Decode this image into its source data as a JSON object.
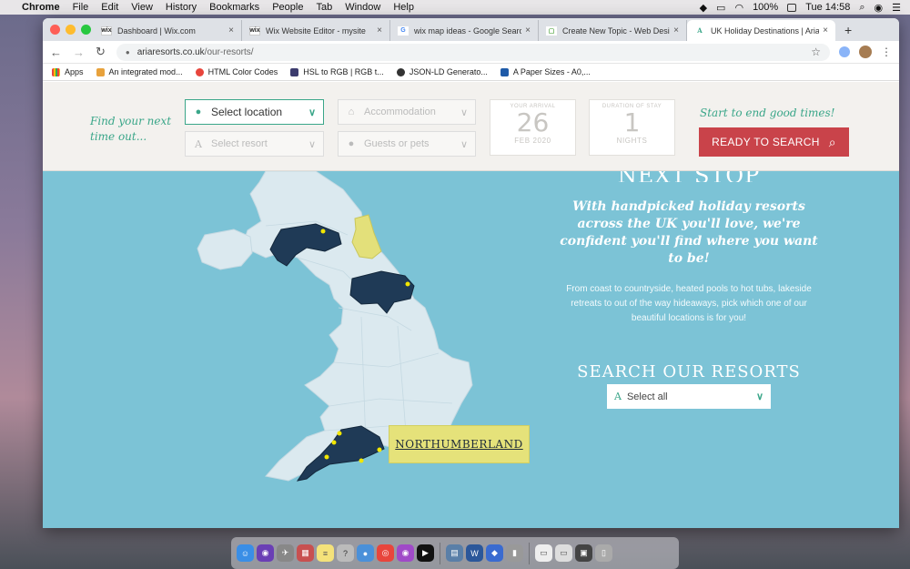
{
  "menubar": {
    "app_name": "Chrome",
    "items": [
      "File",
      "Edit",
      "View",
      "History",
      "Bookmarks",
      "People",
      "Tab",
      "Window",
      "Help"
    ],
    "battery": "100%",
    "clock": "Tue 14:58"
  },
  "tabs": [
    {
      "favicon": "wix",
      "title": "Dashboard | Wix.com",
      "active": false
    },
    {
      "favicon": "wix",
      "title": "Wix Website Editor - mysite",
      "active": false
    },
    {
      "favicon": "G",
      "title": "wix map ideas - Google Search",
      "active": false
    },
    {
      "favicon": "▢",
      "title": "Create New Topic - Web Design",
      "active": false
    },
    {
      "favicon": "A",
      "title": "UK Holiday Destinations | Aria R",
      "active": true
    }
  ],
  "new_tab_label": "+",
  "address": {
    "domain": "ariaresorts.co.uk",
    "path": "/our-resorts/"
  },
  "bookmarks": [
    {
      "label": "Apps",
      "color": "#e8453c"
    },
    {
      "label": "An integrated mod...",
      "color": "#e8a23c"
    },
    {
      "label": "HTML Color Codes",
      "color": "#e8453c"
    },
    {
      "label": "HSL to RGB | RGB t...",
      "color": "#3c3c6e"
    },
    {
      "label": "JSON-LD Generato...",
      "color": "#333333"
    },
    {
      "label": "A Paper Sizes - A0,...",
      "color": "#1e5aa8"
    }
  ],
  "searchbar": {
    "tagline": "Find your next time out...",
    "location_placeholder": "Select location",
    "resort_placeholder": "Select resort",
    "accommodation_placeholder": "Accommodation",
    "guests_placeholder": "Guests or pets",
    "arrival": {
      "label": "YOUR ARRIVAL",
      "day": "26",
      "month": "FEB 2020"
    },
    "duration": {
      "label": "DURATION OF STAY",
      "value": "1",
      "unit": "NIGHTS"
    },
    "cta_tagline": "Start to end good times!",
    "cta_label": "READY TO SEARCH"
  },
  "content": {
    "heading": "NEXT STOP",
    "lead": "With handpicked holiday resorts across the UK you'll love, we're confident you'll find where you want to be!",
    "blurb": "From coast to countryside, heated pools to hot tubs, lakeside retreats to out of the way hideaways, pick which one of our beautiful locations is for you!",
    "search_heading": "SEARCH OUR RESORTS",
    "select_all": "Select all"
  },
  "map": {
    "tooltip": "NORTHUMBERLAND",
    "colors": {
      "sea": "#7cc3d6",
      "land": "#dbe9ef",
      "region": "#1f3a56",
      "highlight": "#e3e07a",
      "marker": "#f2e600"
    }
  }
}
